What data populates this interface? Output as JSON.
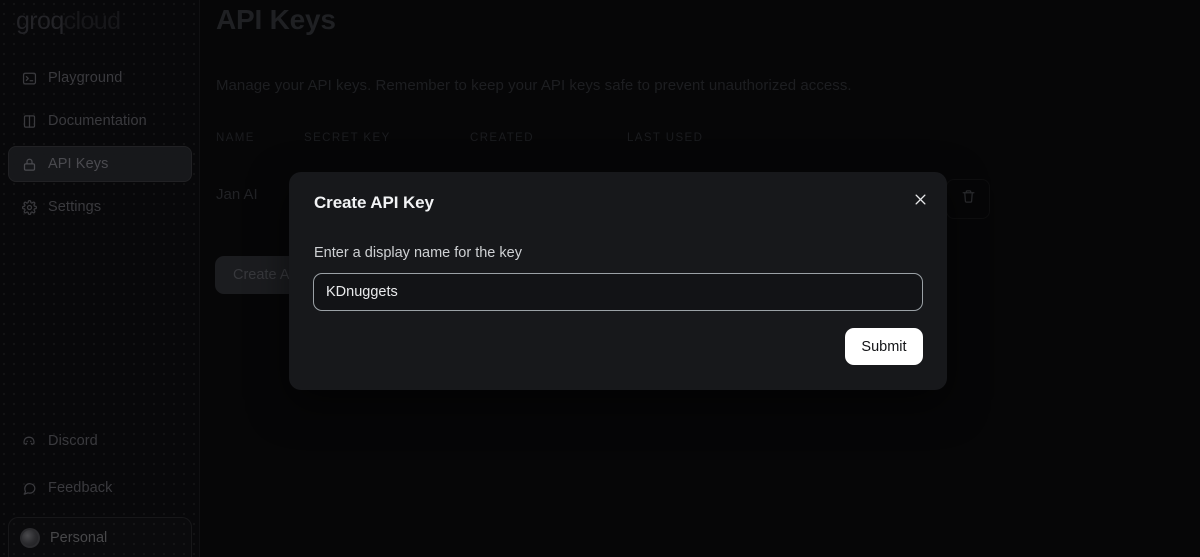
{
  "brand": {
    "part1": "groq",
    "part2": "cloud"
  },
  "sidebar": {
    "items": [
      {
        "label": "Playground",
        "icon": "terminal-icon",
        "active": false
      },
      {
        "label": "Documentation",
        "icon": "book-icon",
        "active": false
      },
      {
        "label": "API Keys",
        "icon": "lock-icon",
        "active": true
      },
      {
        "label": "Settings",
        "icon": "gear-icon",
        "active": false
      }
    ],
    "footer_items": [
      {
        "label": "Discord",
        "icon": "discord-icon"
      },
      {
        "label": "Feedback",
        "icon": "chat-bubble-icon"
      }
    ],
    "account": {
      "label": "Personal",
      "icon": "avatar-icon"
    }
  },
  "main": {
    "title": "API Keys",
    "description": "Manage your API keys. Remember to keep your API keys safe to prevent unauthorized access.",
    "table": {
      "columns": [
        "NAME",
        "SECRET KEY",
        "CREATED",
        "LAST USED"
      ],
      "rows": [
        {
          "name": "Jan AI",
          "delete_icon": "trash-icon"
        }
      ]
    },
    "create_button": "Create API Key"
  },
  "modal": {
    "title": "Create API Key",
    "close_icon": "close-icon",
    "field_label": "Enter a display name for the key",
    "input_value": "KDnuggets",
    "input_placeholder": "",
    "submit_label": "Submit"
  },
  "colors": {
    "page_bg": "#060607",
    "sidebar_bg": "#08080a",
    "modal_bg": "#17181b",
    "submit_bg": "#ffffff",
    "input_border": "#9ba1a6"
  }
}
